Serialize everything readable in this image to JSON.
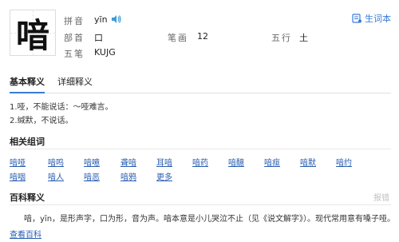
{
  "character": "喑",
  "info": {
    "pinyin_label": "拼音",
    "pinyin_value": "yīn",
    "radical_label": "部首",
    "radical_value": "口",
    "strokes_label": "笔画",
    "strokes_value": "12",
    "wuxing_label": "五行",
    "wuxing_value": "土",
    "wubi_label": "五笔",
    "wubi_value": "KUJG"
  },
  "vocab_label": "生词本",
  "tabs": {
    "basic": "基本释义",
    "detailed": "详细释义"
  },
  "definitions": [
    "1.哑，不能说话：～哑难言。",
    "2.缄默，不说话。"
  ],
  "related_words": {
    "title": "相关组词",
    "row1": [
      "喑哑",
      "喑鸣",
      "喑噫",
      "聋喑",
      "耳喑",
      "喑药",
      "喑醷",
      "喑痖",
      "喑默",
      "喑约"
    ],
    "row2": [
      "喑咽",
      "喑人",
      "喑恶",
      "喑鸦"
    ],
    "more": "更多"
  },
  "encyclopedia": {
    "title": "百科释义",
    "report": "报错",
    "text": "喑，yīn，是形声字，口为形，音为声。喑本意是小儿哭泣不止（见《说文解字》）。现代常用意有嗓子哑。",
    "view_link": "查看百科"
  },
  "colors": {
    "accent": "#3a7bd5",
    "link": "#2a5db0"
  }
}
